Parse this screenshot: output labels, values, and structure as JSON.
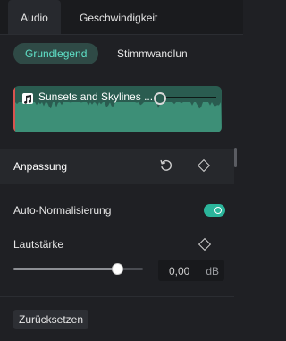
{
  "tabs": {
    "audio": "Audio",
    "speed": "Geschwindigkeit"
  },
  "subtabs": {
    "basic": "Grundlegend",
    "voice_change": "Stimmwandlun"
  },
  "clip": {
    "title": "Sunsets and Skylines ...",
    "icon": "music-note-icon"
  },
  "adjustment": {
    "title": "Anpassung",
    "reset_icon": "reset-icon",
    "keyframe_icon": "keyframe-diamond-icon"
  },
  "auto_normalization": {
    "label": "Auto-Normalisierung",
    "enabled": true
  },
  "volume": {
    "label": "Lautstärke",
    "value": "0,00",
    "unit": "dB",
    "slider_fraction": 0.8
  },
  "reset_button": "Zurücksetzen",
  "colors": {
    "accent": "#5fe0c7",
    "toggle_on": "#2bb59b",
    "clip_bg": "#2a5c50",
    "clip_wave": "#3d8f77"
  }
}
